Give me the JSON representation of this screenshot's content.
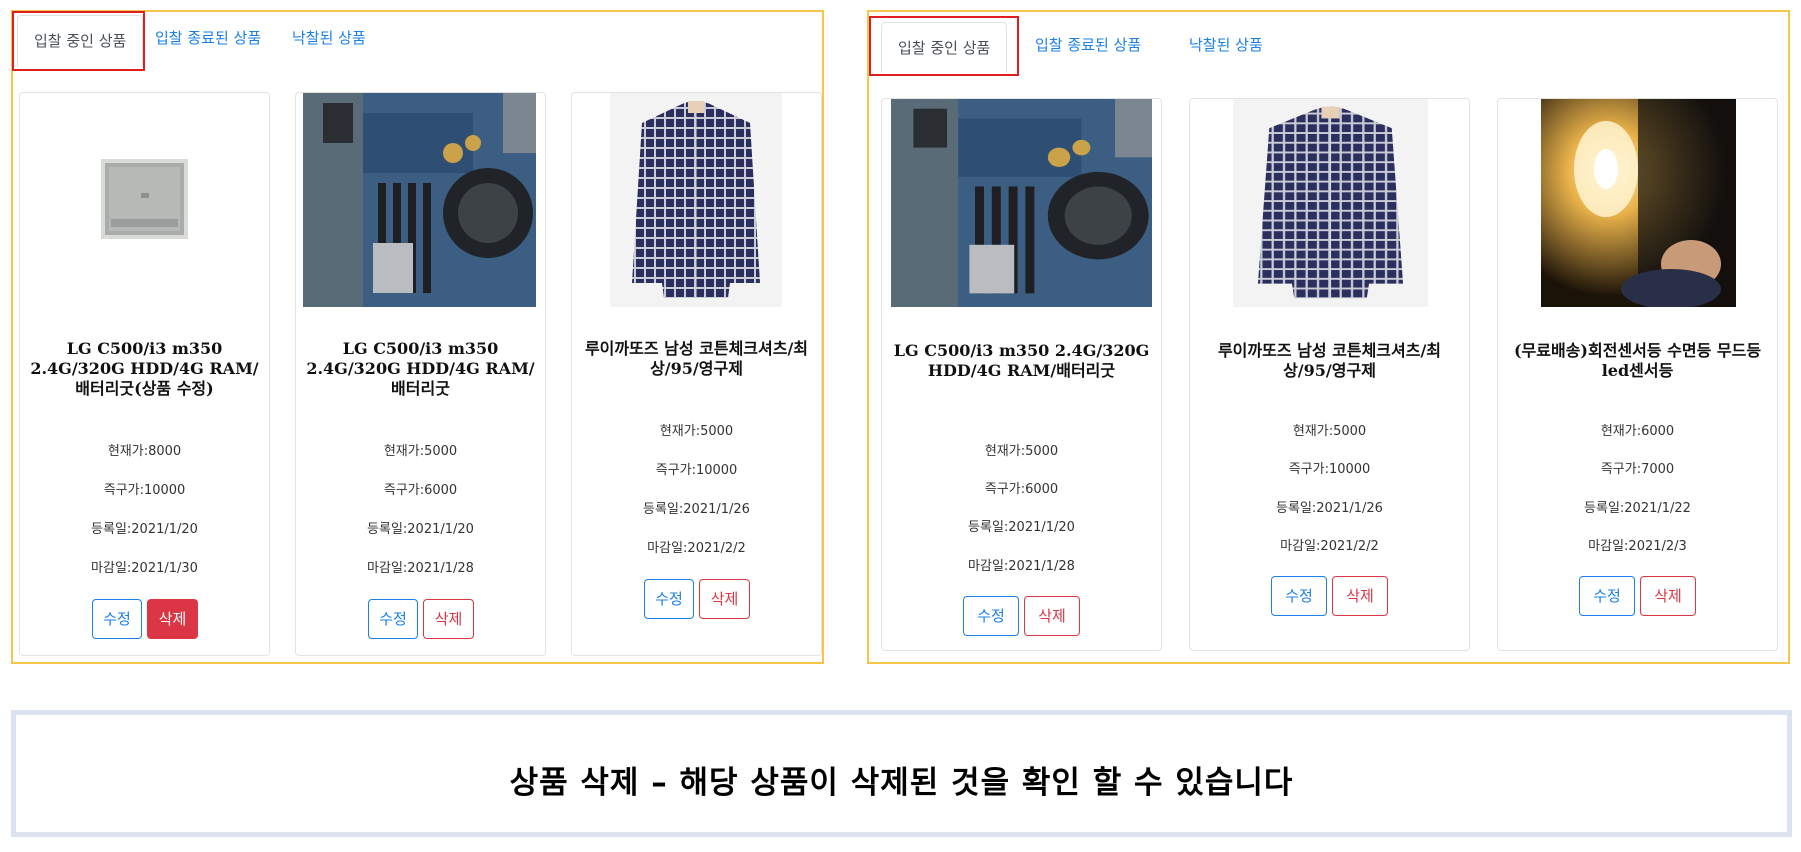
{
  "tabs": {
    "active": "입찰 중인 상품",
    "ended": "입찰 종료된 상품",
    "won": "낙찰된 상품"
  },
  "buttons": {
    "edit": "수정",
    "delete": "삭제"
  },
  "colors": {
    "panel_border": "#f5c64c",
    "highlight": "#e02020",
    "link": "#1a7fe6",
    "danger": "#dc3545",
    "caption_border": "#dbe3f1"
  },
  "before_panel": {
    "products": [
      {
        "title": "LG C500/i3 m350 2.4G/320G HDD/4G RAM/배터리굿(상품 수정)",
        "image": "laptop-thumbnail",
        "current_price": "현재가:8000",
        "buy_now": "즉구가:10000",
        "registered": "등록일:2021/1/20",
        "deadline": "마감일:2021/1/30"
      },
      {
        "title": "LG C500/i3 m350 2.4G/320G HDD/4G RAM/배터리굿",
        "image": "motherboard-photo",
        "current_price": "현재가:5000",
        "buy_now": "즉구가:6000",
        "registered": "등록일:2021/1/20",
        "deadline": "마감일:2021/1/28"
      },
      {
        "title": "루이까또즈 남성 코튼체크셔츠/최상/95/영구제",
        "image": "checked-shirt-photo",
        "current_price": "현재가:5000",
        "buy_now": "즉구가:10000",
        "registered": "등록일:2021/1/26",
        "deadline": "마감일:2021/2/2"
      }
    ]
  },
  "after_panel": {
    "products": [
      {
        "title": "LG C500/i3 m350 2.4G/320G HDD/4G RAM/배터리굿",
        "image": "motherboard-photo",
        "current_price": "현재가:5000",
        "buy_now": "즉구가:6000",
        "registered": "등록일:2021/1/20",
        "deadline": "마감일:2021/1/28"
      },
      {
        "title": "루이까또즈 남성 코튼체크셔츠/최상/95/영구제",
        "image": "checked-shirt-photo",
        "current_price": "현재가:5000",
        "buy_now": "즉구가:10000",
        "registered": "등록일:2021/1/26",
        "deadline": "마감일:2021/2/2"
      },
      {
        "title": "(무료배송)회전센서등 수면등 무드등 led센서등",
        "image": "led-lamp-photo",
        "current_price": "현재가:6000",
        "buy_now": "즉구가:7000",
        "registered": "등록일:2021/1/22",
        "deadline": "마감일:2021/2/3"
      }
    ]
  },
  "caption": "상품 삭제 – 해당 상품이 삭제된 것을 확인 할 수 있습니다"
}
